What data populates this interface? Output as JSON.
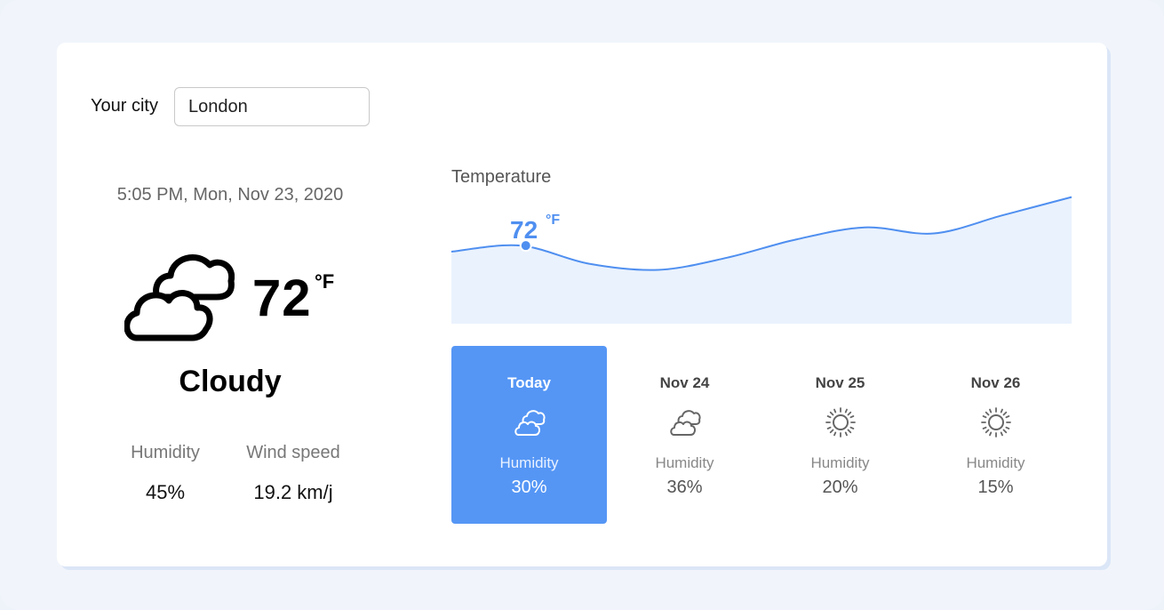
{
  "city": {
    "label": "Your city",
    "value": "London"
  },
  "current": {
    "datetime": "5:05 PM, Mon, Nov 23, 2020",
    "icon": "cloudy-icon",
    "temperature": "72",
    "unit": "°F",
    "condition": "Cloudy",
    "humidity_label": "Humidity",
    "humidity_value": "45%",
    "wind_label": "Wind speed",
    "wind_value": "19.2 km/j"
  },
  "chart": {
    "title": "Temperature",
    "highlight_value": "72",
    "highlight_unit": "°F"
  },
  "chart_data": {
    "type": "area",
    "title": "Temperature",
    "values": [
      71,
      72,
      69,
      68,
      70,
      73,
      75,
      74,
      77,
      80
    ],
    "highlight_index": 1,
    "highlight_value": 72
  },
  "forecast": [
    {
      "name": "Today",
      "icon": "cloudy-icon",
      "humidity_label": "Humidity",
      "humidity_value": "30%",
      "active": true
    },
    {
      "name": "Nov 24",
      "icon": "cloudy-icon",
      "humidity_label": "Humidity",
      "humidity_value": "36%",
      "active": false
    },
    {
      "name": "Nov 25",
      "icon": "sun-icon",
      "humidity_label": "Humidity",
      "humidity_value": "20%",
      "active": false
    },
    {
      "name": "Nov 26",
      "icon": "sun-icon",
      "humidity_label": "Humidity",
      "humidity_value": "15%",
      "active": false
    }
  ],
  "colors": {
    "accent": "#5596f5",
    "chart_line": "#4f8ff0",
    "chart_fill": "#eaf2fd"
  }
}
